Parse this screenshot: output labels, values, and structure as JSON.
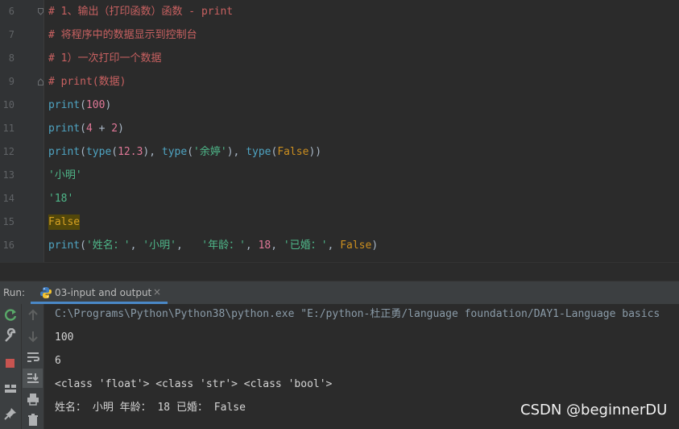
{
  "editor": {
    "lines": [
      {
        "num": "6",
        "parts": [
          {
            "t": "# 1、输出（打印函数）函数 - print",
            "c": "cm"
          }
        ]
      },
      {
        "num": "7",
        "parts": [
          {
            "t": "# 将程序中的数据显示到控制台",
            "c": "cm"
          }
        ]
      },
      {
        "num": "8",
        "parts": [
          {
            "t": "# 1）一次打印一个数据",
            "c": "cm"
          }
        ]
      },
      {
        "num": "9",
        "parts": [
          {
            "t": "# print(数据)",
            "c": "cm"
          }
        ]
      },
      {
        "num": "10",
        "parts": [
          {
            "t": "print",
            "c": "fn"
          },
          {
            "t": "(",
            "c": "pu"
          },
          {
            "t": "100",
            "c": "num"
          },
          {
            "t": ")",
            "c": "pu"
          }
        ]
      },
      {
        "num": "11",
        "parts": [
          {
            "t": "print",
            "c": "fn"
          },
          {
            "t": "(",
            "c": "pu"
          },
          {
            "t": "4",
            "c": "num"
          },
          {
            "t": " + ",
            "c": "pu"
          },
          {
            "t": "2",
            "c": "num"
          },
          {
            "t": ")",
            "c": "pu"
          }
        ]
      },
      {
        "num": "12",
        "parts": [
          {
            "t": "print",
            "c": "fn"
          },
          {
            "t": "(",
            "c": "pu"
          },
          {
            "t": "type",
            "c": "fn"
          },
          {
            "t": "(",
            "c": "pu"
          },
          {
            "t": "12.3",
            "c": "num"
          },
          {
            "t": "), ",
            "c": "pu"
          },
          {
            "t": "type",
            "c": "fn"
          },
          {
            "t": "(",
            "c": "pu"
          },
          {
            "t": "'余婷'",
            "c": "str"
          },
          {
            "t": "), ",
            "c": "pu"
          },
          {
            "t": "type",
            "c": "fn"
          },
          {
            "t": "(",
            "c": "pu"
          },
          {
            "t": "False",
            "c": "kw"
          },
          {
            "t": "))",
            "c": "pu"
          }
        ]
      },
      {
        "num": "13",
        "parts": [
          {
            "t": "'小明'",
            "c": "str"
          }
        ]
      },
      {
        "num": "14",
        "parts": [
          {
            "t": "'18'",
            "c": "str"
          }
        ]
      },
      {
        "num": "15",
        "parts": [
          {
            "t": "False",
            "c": "hl"
          }
        ]
      },
      {
        "num": "16",
        "parts": [
          {
            "t": "print",
            "c": "fn"
          },
          {
            "t": "(",
            "c": "pu"
          },
          {
            "t": "'姓名：'",
            "c": "str"
          },
          {
            "t": ", ",
            "c": "pu"
          },
          {
            "t": "'小明'",
            "c": "str"
          },
          {
            "t": ",   ",
            "c": "pu"
          },
          {
            "t": "'年龄：'",
            "c": "str"
          },
          {
            "t": ", ",
            "c": "pu"
          },
          {
            "t": "18",
            "c": "num"
          },
          {
            "t": ", ",
            "c": "pu"
          },
          {
            "t": "'已婚：'",
            "c": "str"
          },
          {
            "t": ", ",
            "c": "pu"
          },
          {
            "t": "False",
            "c": "kw"
          },
          {
            "t": ")",
            "c": "pu"
          }
        ]
      }
    ]
  },
  "run_panel": {
    "label": "Run:",
    "tab_label": "03-input and output",
    "tab_close": "×"
  },
  "console": {
    "lines": [
      "C:\\Programs\\Python\\Python38\\python.exe \"E:/python-杜正勇/language foundation/DAY1-Language basics",
      "100",
      "6",
      "<class 'float'> <class 'str'> <class 'bool'>",
      "姓名： 小明 年龄： 18 已婚： False"
    ]
  },
  "watermark": "CSDN @beginnerDU",
  "icons": [
    "fold-icon",
    "python-icon",
    "rerun-icon",
    "wrench-icon",
    "stop-icon",
    "layout-icon",
    "pin-icon",
    "up-arrow-icon",
    "down-arrow-icon",
    "soft-wrap-icon",
    "scroll-to-end-icon",
    "print-icon",
    "trash-icon"
  ]
}
